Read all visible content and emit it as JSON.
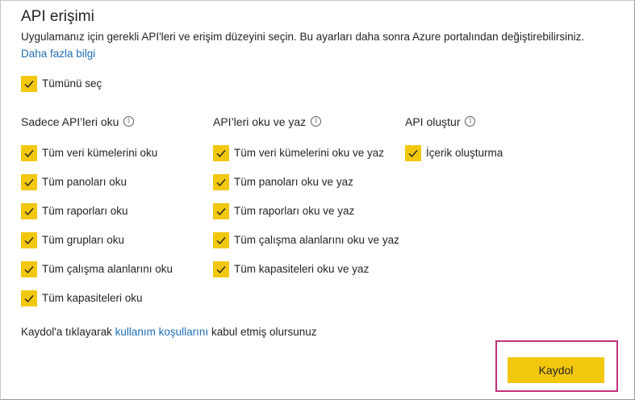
{
  "dialog": {
    "title": "API erişimi",
    "description": "Uygulamanız için gerekli API'leri ve erişim düzeyini seçin. Bu ayarları daha sonra Azure portalından değiştirebilirsiniz.",
    "learn_more": "Daha fazla bilgi",
    "select_all": {
      "label": "Tümünü seç",
      "checked": true
    }
  },
  "columns": [
    {
      "header": "Sadece API’leri oku",
      "items": [
        {
          "label": "Tüm veri kümelerini oku",
          "checked": true
        },
        {
          "label": "Tüm panoları oku",
          "checked": true
        },
        {
          "label": "Tüm raporları oku",
          "checked": true
        },
        {
          "label": "Tüm grupları oku",
          "checked": true
        },
        {
          "label": "Tüm çalışma alanlarını oku",
          "checked": true
        },
        {
          "label": "Tüm kapasiteleri oku",
          "checked": true
        }
      ]
    },
    {
      "header": "API’leri oku ve yaz",
      "items": [
        {
          "label": "Tüm veri kümelerini oku ve yaz",
          "checked": true
        },
        {
          "label": "Tüm panoları oku ve yaz",
          "checked": true
        },
        {
          "label": "Tüm raporları oku ve yaz",
          "checked": true
        },
        {
          "label": "Tüm çalışma alanlarını oku ve yaz",
          "checked": true
        },
        {
          "label": "Tüm kapasiteleri oku ve yaz",
          "checked": true
        }
      ]
    },
    {
      "header": "API oluştur",
      "items": [
        {
          "label": "İçerik oluşturma",
          "checked": true
        }
      ]
    }
  ],
  "info_glyph": "i",
  "terms": {
    "prefix": "Kaydol'a tıklayarak ",
    "link": "kullanım koşullarını",
    "suffix": " kabul etmiş olursunuz"
  },
  "register_button": "Kaydol",
  "colors": {
    "accent": "#f2c80f",
    "link": "#1f6fb5",
    "highlight": "#c0317a"
  }
}
